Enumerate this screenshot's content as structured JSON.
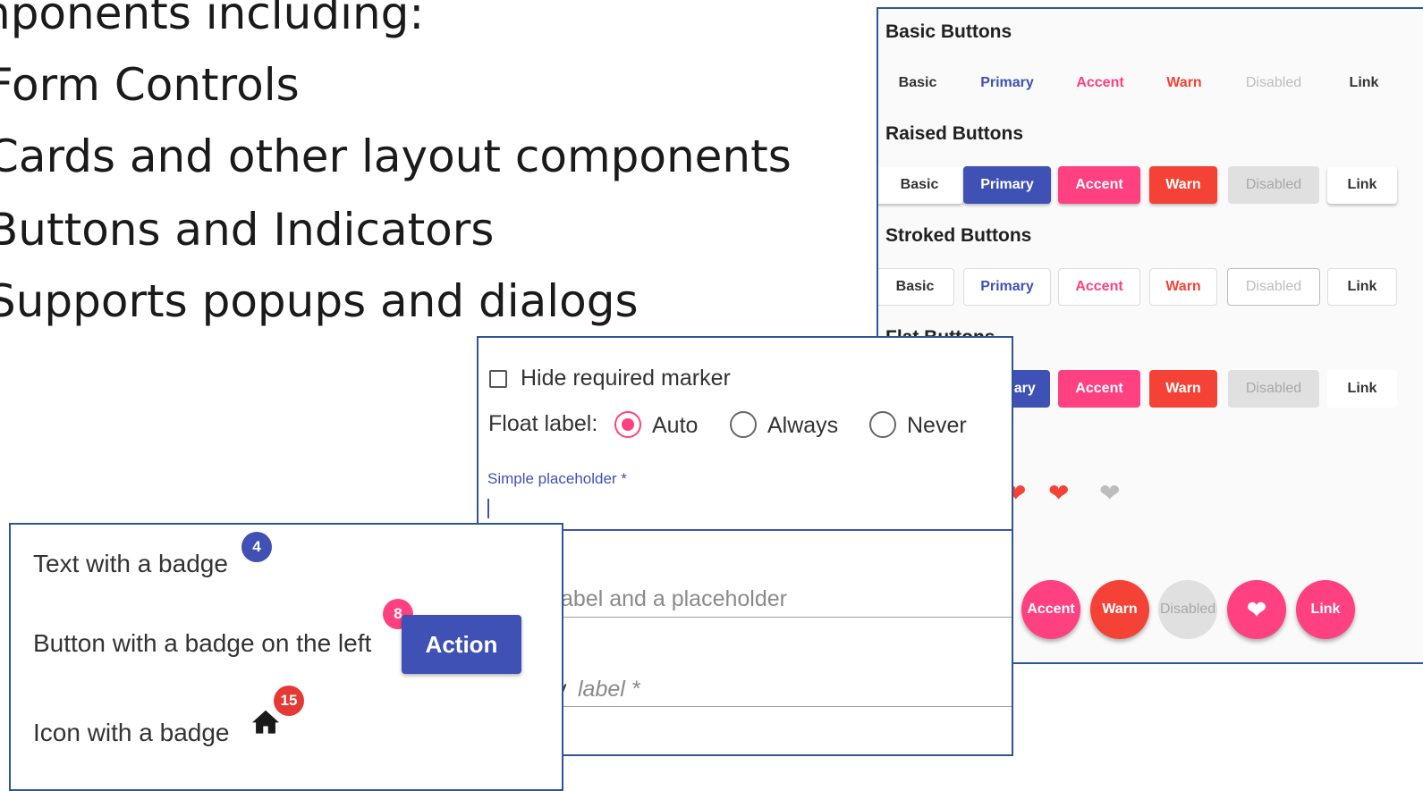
{
  "slide": {
    "title_fragment": "nponents including:",
    "bullets": [
      "Form Controls",
      "Cards and other layout components",
      "Buttons and Indicators",
      "Supports popups and dialogs"
    ]
  },
  "buttons_panel": {
    "basic": {
      "title": "Basic Buttons",
      "labels": [
        "Basic",
        "Primary",
        "Accent",
        "Warn",
        "Disabled",
        "Link"
      ]
    },
    "raised": {
      "title": "Raised Buttons",
      "labels": [
        "Basic",
        "Primary",
        "Accent",
        "Warn",
        "Disabled",
        "Link"
      ]
    },
    "stroked": {
      "title": "Stroked Buttons",
      "labels": [
        "Basic",
        "Primary",
        "Accent",
        "Warn",
        "Disabled",
        "Link"
      ]
    },
    "flat": {
      "title": "Flat Buttons",
      "labels": [
        "Primary",
        "Accent",
        "Warn",
        "Disabled",
        "Link"
      ]
    },
    "fab": {
      "labels": [
        "Accent",
        "Warn",
        "Disabled",
        "Link"
      ]
    },
    "icons": [
      "heart-icon",
      "heart-icon",
      "heart-icon"
    ],
    "colors": {
      "primary": "#3f51b5",
      "accent": "#ff4081",
      "warn": "#f44336",
      "disabled": "#e0e0e0"
    }
  },
  "form_panel": {
    "checkbox_label": "Hide required marker",
    "float_label": "Float label:",
    "radios": [
      {
        "label": "Auto",
        "checked": true
      },
      {
        "label": "Always",
        "checked": false
      },
      {
        "label": "Never",
        "checked": false
      }
    ],
    "field1_label": "Simple placeholder *",
    "field2_text": "abel and a placeholder",
    "field3_prefix": "y ",
    "field3_label": "label *"
  },
  "badges_panel": {
    "row1_text": "Text with a badge",
    "row1_badge": "4",
    "row2_text": "Button with a badge on the left",
    "row2_badge": "8",
    "action_label": "Action",
    "row3_text": "Icon with a badge",
    "row3_badge": "15",
    "badge_colors": {
      "primary": "#3f51b5",
      "accent": "#ff4081",
      "warn": "#e53935"
    }
  }
}
